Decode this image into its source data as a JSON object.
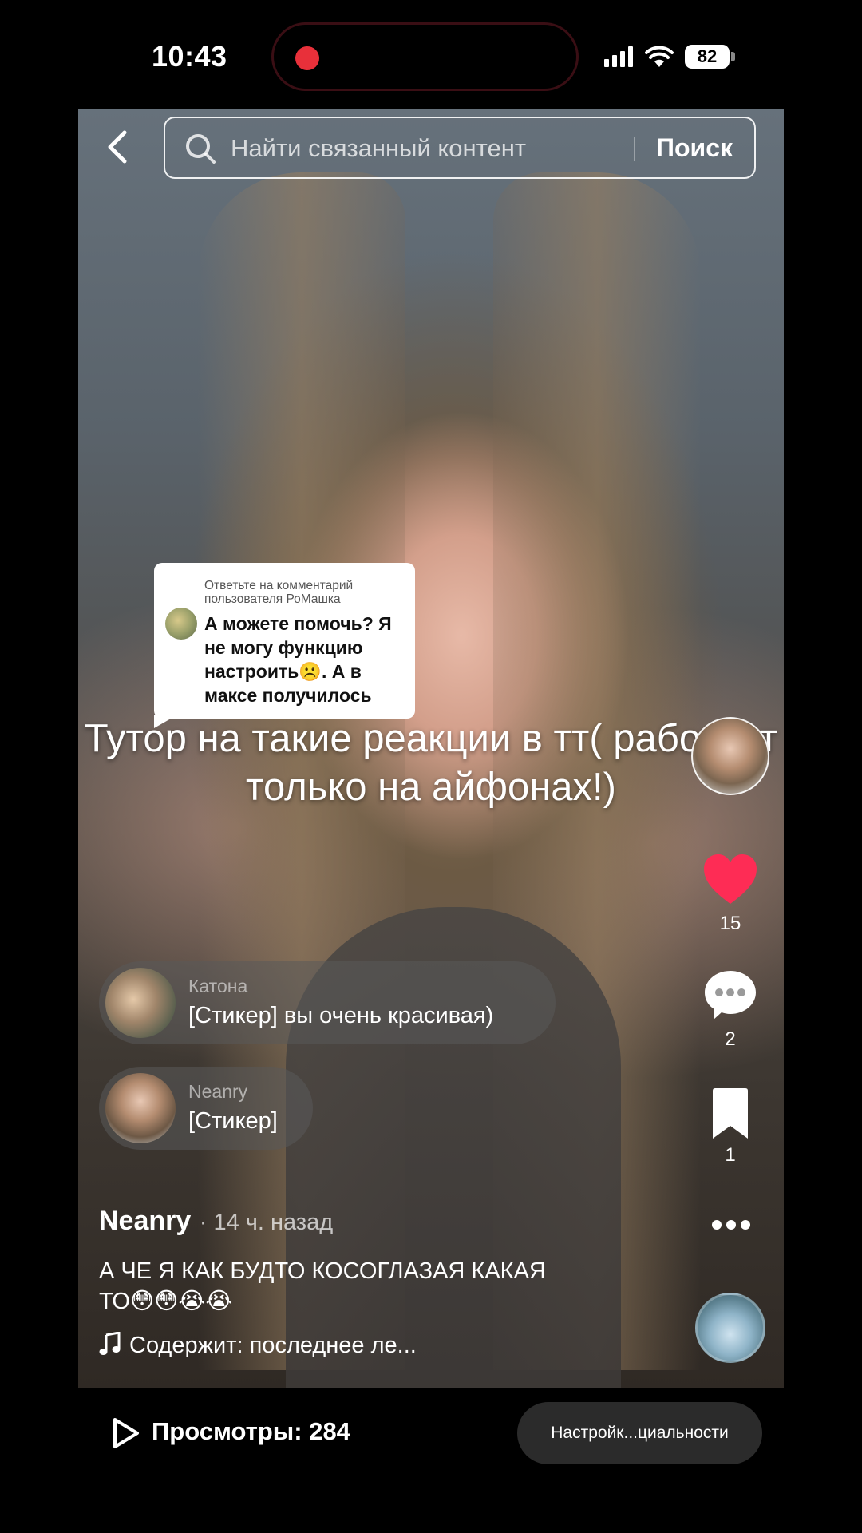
{
  "status_bar": {
    "time": "10:43",
    "battery": "82"
  },
  "search": {
    "placeholder": "Найти связанный контент",
    "button_label": "Поиск"
  },
  "reply_card": {
    "caption": "Ответьте на комментарий пользователя РоМашка",
    "text": "А можете помочь? Я не могу функцию настроить☹️. А в максе получилось"
  },
  "overlay_title": "Тутор на такие реакции в тт( работает только на айфонах!)",
  "actions": {
    "likes": "15",
    "comments": "2",
    "saves": "1"
  },
  "comments": [
    {
      "author": "Катона",
      "text": "[Стикер] вы очень красивая)"
    },
    {
      "author": "Neanry",
      "text": "[Стикер]"
    }
  ],
  "post": {
    "author": "Neanry",
    "time": "· 14 ч. назад",
    "caption": "А ЧЕ Я КАК БУДТО  КОСОГЛАЗАЯ КАКАЯ ТО😳😳😭😭",
    "music": "Содержит: последнее ле..."
  },
  "bottom_bar": {
    "views": "Просмотры: 284",
    "privacy": "Настройк...циальности"
  },
  "colors": {
    "like_red": "#fe2c55",
    "record_red": "#e8303a"
  },
  "icons": [
    "back-icon",
    "search-icon",
    "heart-icon",
    "comment-icon",
    "bookmark-icon",
    "more-icon",
    "music-note-icon",
    "play-icon"
  ]
}
